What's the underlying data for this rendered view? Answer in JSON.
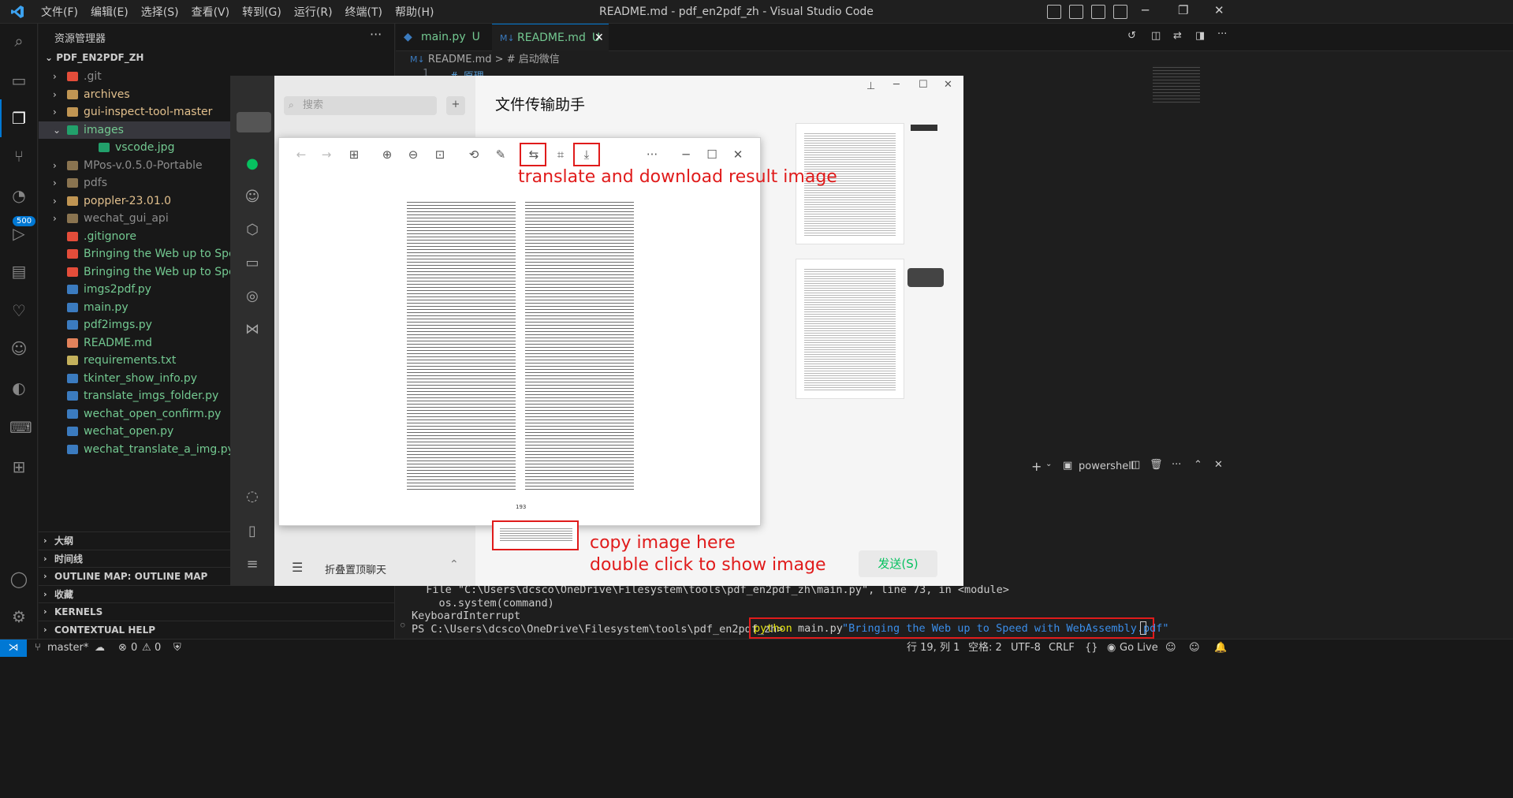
{
  "window": {
    "title": "README.md - pdf_en2pdf_zh - Visual Studio Code",
    "menu": [
      "文件(F)",
      "编辑(E)",
      "选择(S)",
      "查看(V)",
      "转到(G)",
      "运行(R)",
      "终端(T)",
      "帮助(H)"
    ]
  },
  "activity": {
    "source_control_badge": "500"
  },
  "sidebar": {
    "header": "资源管理器",
    "root": "PDF_EN2PDF_ZH",
    "items": [
      {
        "name": ".git",
        "type": "folder-git"
      },
      {
        "name": "archives",
        "type": "folder"
      },
      {
        "name": "gui-inspect-tool-master",
        "type": "folder"
      },
      {
        "name": "images",
        "type": "folder-images"
      },
      {
        "name": "vscode.jpg",
        "type": "image"
      },
      {
        "name": "MPos-v.0.5.0-Portable",
        "type": "folder-dim"
      },
      {
        "name": "pdfs",
        "type": "folder-dim"
      },
      {
        "name": "poppler-23.01.0",
        "type": "folder"
      },
      {
        "name": "wechat_gui_api",
        "type": "folder-dim"
      },
      {
        "name": ".gitignore",
        "type": "git-file"
      },
      {
        "name": "Bringing the Web up to Speed w",
        "type": "pdf"
      },
      {
        "name": "Bringing the Web up to Speed w",
        "type": "pdf"
      },
      {
        "name": "imgs2pdf.py",
        "type": "py"
      },
      {
        "name": "main.py",
        "type": "py"
      },
      {
        "name": "pdf2imgs.py",
        "type": "py"
      },
      {
        "name": "README.md",
        "type": "md"
      },
      {
        "name": "requirements.txt",
        "type": "txt"
      },
      {
        "name": "tkinter_show_info.py",
        "type": "py"
      },
      {
        "name": "translate_imgs_folder.py",
        "type": "py"
      },
      {
        "name": "wechat_open_confirm.py",
        "type": "py"
      },
      {
        "name": "wechat_open.py",
        "type": "py"
      },
      {
        "name": "wechat_translate_a_img.py",
        "type": "py"
      }
    ],
    "sections": [
      "大纲",
      "时间线",
      "OUTLINE MAP: OUTLINE MAP",
      "收藏",
      "KERNELS",
      "CONTEXTUAL HELP"
    ]
  },
  "tabs": [
    {
      "label": "main.py",
      "mod": "U"
    },
    {
      "label": "README.md",
      "mod": "U"
    }
  ],
  "breadcrumb": {
    "file": "README.md",
    "sep": ">",
    "section": "# 启动微信",
    "line_no": "1",
    "line_text": "# 原理"
  },
  "terminal": {
    "shell": "powershell",
    "lines": [
      "  File \"C:\\Users\\dcsco\\OneDrive\\Filesystem\\tools\\pdf_en2pdf_zh\\main.py\", line 73, in <module>",
      "    os.system(command)",
      "KeyboardInterrupt",
      "PS C:\\Users\\dcsco\\OneDrive\\Filesystem\\tools\\pdf_en2pdf_zh>"
    ],
    "command_keyword": "python",
    "command_arg": "main.py",
    "command_string": "\"Bringing the Web up to Speed with WebAssembly.pdf\""
  },
  "status": {
    "branch": "master*",
    "errors": "0",
    "warnings": "0",
    "position": "行 19, 列 1",
    "spaces": "空格: 2",
    "encoding": "UTF-8",
    "eol": "CRLF",
    "golive": "Go Live"
  },
  "wechat": {
    "search_placeholder": "搜索",
    "chat_title": "文件传输助手",
    "fold_label": "折叠置顶聊天",
    "send_button": "发送(S)"
  },
  "viewer": {
    "page_number": "193"
  },
  "annotations": {
    "translate": "translate and download result image",
    "copy": "copy image here",
    "dblclick": "double click to show image"
  },
  "colors": {
    "accent": "#0078d4",
    "annotation": "#e01b1b",
    "untracked": "#73c991",
    "wechat_green": "#07c160"
  }
}
